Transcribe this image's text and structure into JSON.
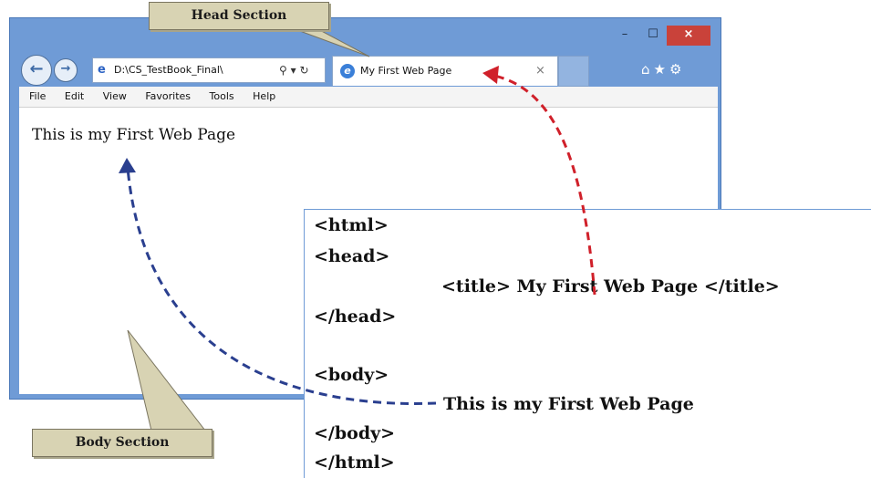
{
  "callouts": {
    "head": "Head Section",
    "body": "Body Section"
  },
  "browser": {
    "window_controls": {
      "minimize": "–",
      "maximize": "☐",
      "close": "×"
    },
    "nav": {
      "back": "←",
      "forward": "→"
    },
    "address": {
      "value": "D:\\CS_TestBook_Final\\",
      "tools": "⚲ ▾ ↻"
    },
    "tab": {
      "title": "My First Web Page",
      "close": "×"
    },
    "toolbar_icons": "⌂★⚙",
    "menu": [
      "File",
      "Edit",
      "View",
      "Favorites",
      "Tools",
      "Help"
    ],
    "page_text": "This is my First Web Page"
  },
  "code_lines": {
    "html_open": "<html>",
    "head_open": "<head>",
    "title_line": "<title> My First Web Page </title>",
    "head_close": "</head>",
    "body_open": "<body>",
    "body_text": "This is my First Web Page",
    "body_close": "</body>",
    "html_close": "</html>"
  },
  "colors": {
    "window_frame": "#6f9bd6",
    "close_button": "#c9423a",
    "callout_fill": "#d8d3b3",
    "head_arrow": "#d0202a",
    "body_arrow": "#2a3f8f"
  },
  "icons": [
    "back-arrow-icon",
    "forward-arrow-icon",
    "page-icon",
    "ie-logo-icon",
    "home-icon",
    "star-icon",
    "gear-icon"
  ]
}
